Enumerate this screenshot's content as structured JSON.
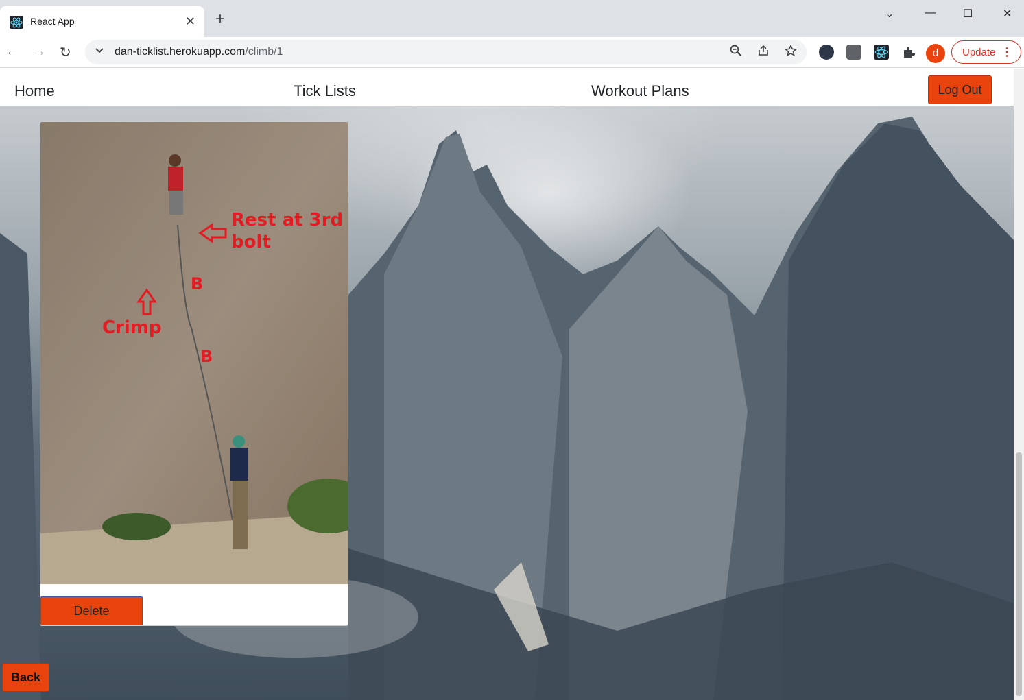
{
  "browser": {
    "tab_title": "React App",
    "tab_close": "✕",
    "new_tab": "+",
    "url_host": "dan-ticklist.herokuapp.com",
    "url_path": "/climb/1",
    "update_label": "Update",
    "avatar_letter": "d",
    "back_glyph": "←",
    "forward_glyph": "→",
    "reload_glyph": "↻",
    "minimize": "—",
    "maximize": "☐",
    "close": "✕",
    "tab_search": "⌄"
  },
  "nav": {
    "home": "Home",
    "tick_lists": "Tick Lists",
    "workout_plans": "Workout Plans",
    "logout": "Log Out"
  },
  "climb": {
    "annotations": {
      "rest": "Rest at 3rd",
      "rest2": "bolt",
      "crimp": "Crimp",
      "bolt1": "B",
      "bolt2": "B"
    },
    "delete_label": "Delete"
  },
  "page": {
    "back_label": "Back"
  },
  "colors": {
    "accent": "#e8430c",
    "annotation": "#e31b23"
  }
}
